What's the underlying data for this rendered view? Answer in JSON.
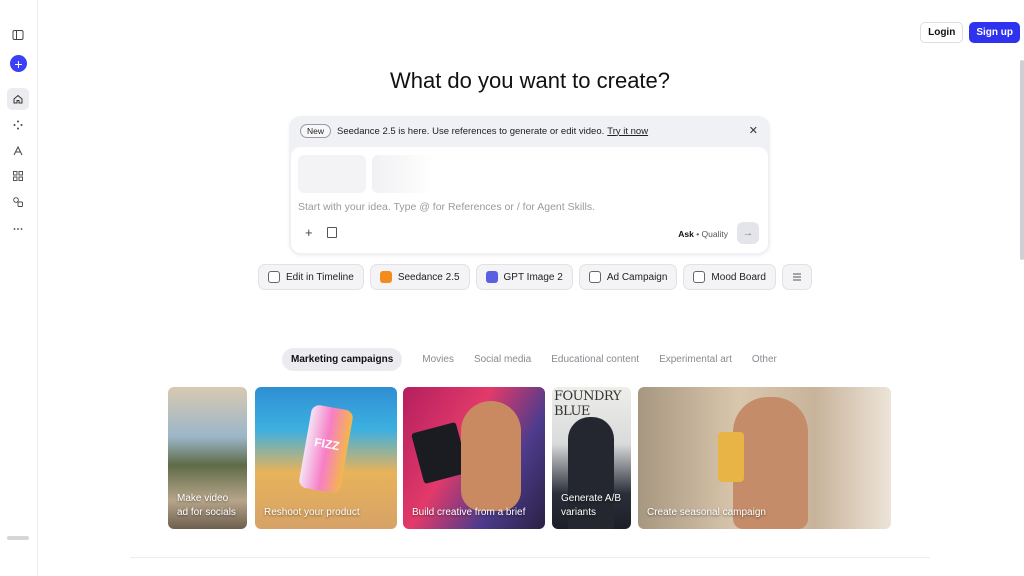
{
  "header": {
    "login": "Login",
    "signup": "Sign up"
  },
  "headline": "What do you want to create?",
  "composer": {
    "badge": "New",
    "announcement": "Seedance 2.5 is here. Use references to generate or edit video.",
    "announcement_link": "Try it now",
    "placeholder": "Start with your idea. Type @ for References or / for Agent Skills.",
    "mode": "Ask",
    "quality": "Quality"
  },
  "chips": [
    {
      "label": "Edit in Timeline",
      "icon": "timeline-icon"
    },
    {
      "label": "Seedance 2.5",
      "icon": "seedance-icon"
    },
    {
      "label": "GPT Image 2",
      "icon": "gpt-icon"
    },
    {
      "label": "Ad Campaign",
      "icon": "document-icon"
    },
    {
      "label": "Mood Board",
      "icon": "document-icon"
    }
  ],
  "tabs": [
    "Marketing campaigns",
    "Movies",
    "Social media",
    "Educational content",
    "Experimental art",
    "Other"
  ],
  "cards": [
    {
      "caption_line1": "Make video",
      "caption_line2": "ad for socials"
    },
    {
      "caption_line1": "Reshoot your product",
      "caption_line2": ""
    },
    {
      "caption_line1": "Build creative from a brief",
      "caption_line2": ""
    },
    {
      "caption_line1": "Generate A/B",
      "caption_line2": "variants"
    },
    {
      "caption_line1": "Create seasonal campaign",
      "caption_line2": ""
    }
  ],
  "card_art": {
    "can_text": "FIZZ",
    "poster_text": "FOUNDRY BLUE"
  },
  "colors": {
    "accent": "#2f33f0",
    "seedance": "#f28c1e",
    "gpt": "#5b5fe0"
  }
}
